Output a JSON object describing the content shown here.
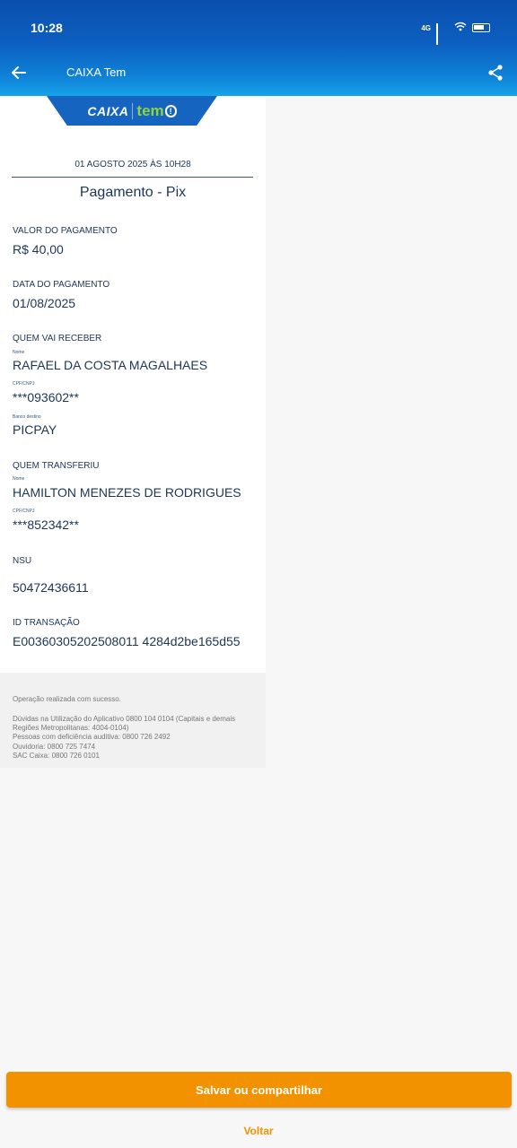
{
  "status_bar": {
    "time": "10:28",
    "network": "4G"
  },
  "header": {
    "title": "CAIXA Tem"
  },
  "logo": {
    "caixa": "CAIXA",
    "tem": "tem",
    "exclaim": "!"
  },
  "receipt": {
    "date": "01 AGOSTO 2025 ÀS 10H28",
    "title": "Pagamento - Pix",
    "payment_value_label": "VALOR DO PAGAMENTO",
    "payment_value": "R$ 40,00",
    "payment_date_label": "DATA DO PAGAMENTO",
    "payment_date": "01/08/2025",
    "receiver_label": "QUEM VAI RECEBER",
    "receiver_name_label": "Nome",
    "receiver_name": "RAFAEL DA COSTA MAGALHAES",
    "receiver_doc_label": "CPF/CNPJ",
    "receiver_doc": "***093602**",
    "receiver_bank_label": "Banco destino",
    "receiver_bank": "PICPAY",
    "sender_label": "QUEM TRANSFERIU",
    "sender_name_label": "Nome",
    "sender_name": "HAMILTON MENEZES DE RODRIGUES",
    "sender_doc_label": "CPF/CNPJ",
    "sender_doc": "***852342**",
    "nsu_label": "NSU",
    "nsu": "50472436611",
    "transaction_id_label": "ID TRANSAÇÃO",
    "transaction_id": "E00360305202508011 4284d2be165d55"
  },
  "info": {
    "success": "Operação realizada com sucesso.",
    "help_line1": "Dúvidas na Utilização do Aplicativo 0800 104 0104 (Capitais e demais",
    "help_line2": "Regiões Metropolitanas: 4004-0104)",
    "hearing": "Pessoas com deficiência auditiva: 0800 726 2492",
    "ombudsman": "Ouvidoria: 0800 725 7474",
    "sac": "SAC Caixa: 0800 726 0101"
  },
  "actions": {
    "save_share": "Salvar ou compartilhar",
    "back": "Voltar"
  },
  "colors": {
    "header": "#0c5fc0",
    "accent": "#f39200",
    "text": "#1d3557"
  }
}
